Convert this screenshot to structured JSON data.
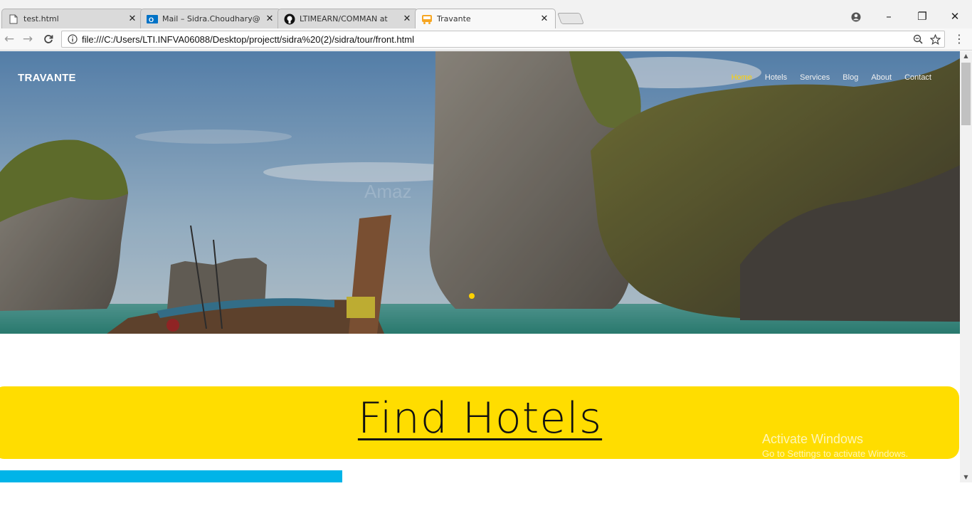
{
  "browser": {
    "tabs": [
      {
        "title": "test.html",
        "icon": "document-icon"
      },
      {
        "title": "Mail – Sidra.Choudhary@",
        "icon": "outlook-icon"
      },
      {
        "title": "LTIMEARN/COMMAN at",
        "icon": "github-icon"
      },
      {
        "title": "Travante",
        "icon": "bus-icon",
        "active": true
      }
    ],
    "close_glyph": "✕",
    "url": "file:///C:/Users/LTI.INFVA06088/Desktop/projectt/sidra%20(2)/sidra/tour/front.html",
    "nav": {
      "back": "←",
      "forward": "→",
      "reload": "C"
    },
    "window_controls": {
      "minimize": "–",
      "restore": "❐",
      "close": "✕"
    }
  },
  "page": {
    "brand": "TRAVANTE",
    "nav_items": [
      "Home",
      "Hotels",
      "Services",
      "Blog",
      "About",
      "Contact"
    ],
    "active_nav": "Home",
    "hero_watermark": "Amaz",
    "find_hotels": "Find Hotels",
    "activate_title": "Activate Windows",
    "activate_sub": "Go to Settings to activate Windows."
  },
  "colors": {
    "accent_yellow": "#ffdd00",
    "accent_blue": "#00b4e8",
    "nav_active": "#ffd200"
  }
}
